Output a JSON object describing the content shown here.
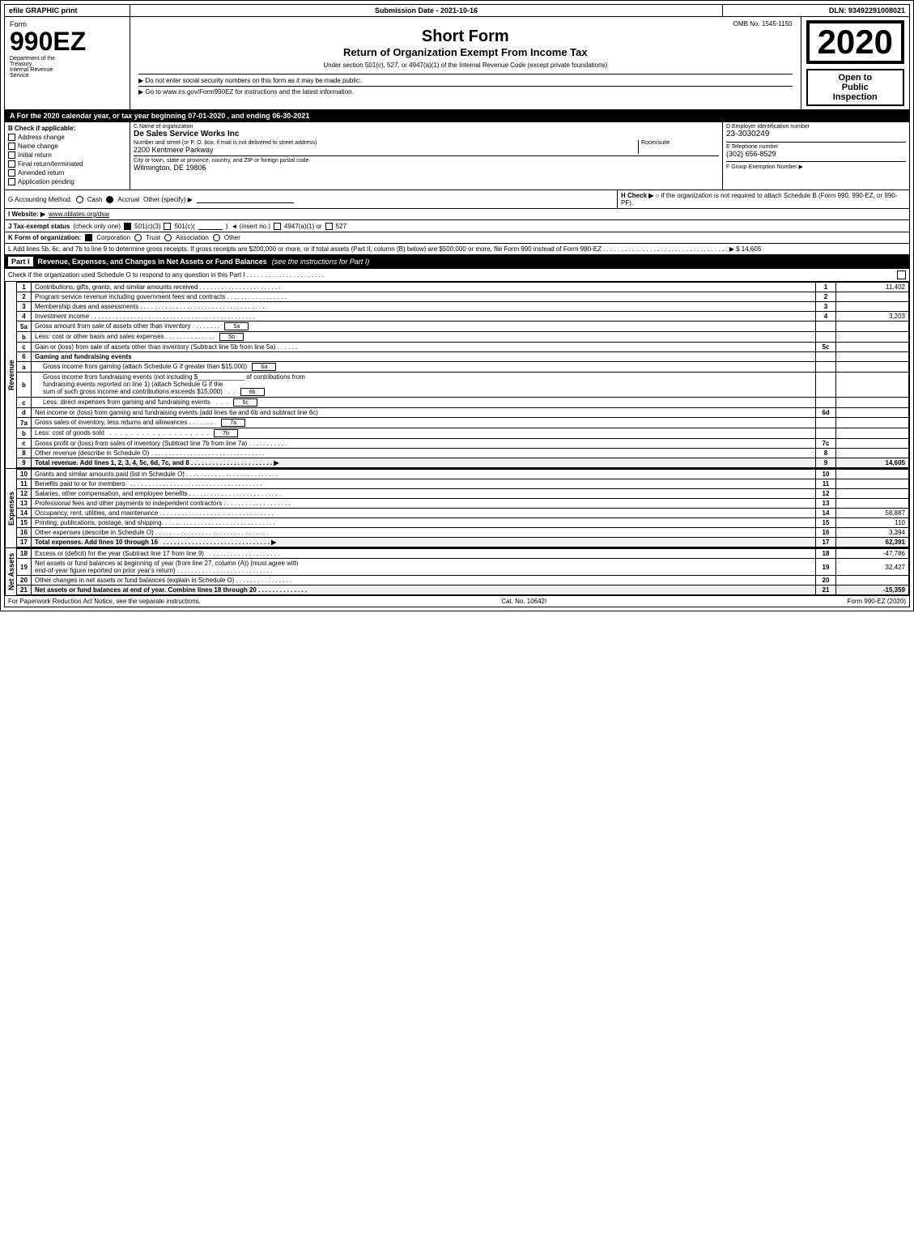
{
  "header": {
    "efile_label": "efile GRAPHIC print",
    "submission_label": "Submission Date - 2021-10-16",
    "dln_label": "DLN: 93492291008021"
  },
  "form_info": {
    "omb": "OMB No. 1545-1150",
    "form_number": "990EZ",
    "form_label": "Form",
    "short_form": "Short Form",
    "return_title": "Return of Organization Exempt From Income Tax",
    "subtitle": "Under section 501(c), 527, or 4947(a)(1) of the Internal Revenue Code (except private foundations)",
    "year": "2020",
    "note1": "▶ Do not enter social security numbers on this form as it may be made public.",
    "note2": "▶ Go to www.irs.gov/Form990EZ for instructions and the latest information.",
    "dept_line1": "Department of the",
    "dept_line2": "Treasury",
    "dept_line3": "Internal Revenue",
    "dept_line4": "Service"
  },
  "open_to_public": {
    "line1": "Open to",
    "line2": "Public",
    "line3": "Inspection"
  },
  "section_A": {
    "year_line": "A For the 2020 calendar year, or tax year beginning 07-01-2020 , and ending 06-30-2021",
    "check_label": "B Check if applicable:",
    "checks": [
      {
        "label": "Address change",
        "checked": false
      },
      {
        "label": "Name change",
        "checked": false
      },
      {
        "label": "Initial return",
        "checked": false
      },
      {
        "label": "Final return/terminated",
        "checked": false
      },
      {
        "label": "Amended return",
        "checked": false
      },
      {
        "label": "Application pending",
        "checked": false
      }
    ],
    "c_label": "C Name of organization",
    "org_name": "De Sales Service Works Inc",
    "address_label": "Number and street (or P. O. box, if mail is not delivered to street address)",
    "address_value": "2200 Kentmere Parkway",
    "room_suite_label": "Room/suite",
    "room_suite_value": "",
    "city_label": "City or town, state or province, country, and ZIP or foreign postal code",
    "city_value": "Wilmington, DE  19806",
    "d_label": "D Employer identification number",
    "ein": "23-3030249",
    "e_label": "E Telephone number",
    "phone": "(302) 656-8529",
    "f_label": "F Group Exemption Number",
    "f_arrow": "▶"
  },
  "accounting": {
    "g_label": "G Accounting Method:",
    "cash_label": "Cash",
    "cash_checked": false,
    "accrual_label": "Accrual",
    "accrual_checked": true,
    "other_label": "Other (specify) ▶",
    "other_line": "___________________________",
    "h_label": "H Check ▶",
    "h_text": "○ if the organization is not required to attach Schedule B (Form 990, 990-EZ, or 990-PF)."
  },
  "website": {
    "i_label": "I Website: ▶",
    "url": "www.oblates.org/dsw"
  },
  "tax_status": {
    "j_label": "J Tax-exempt status",
    "j_note": "(check only one)",
    "checked_501c3": true,
    "label_501c3": "501(c)(3)",
    "label_501c": "501(c)(",
    "insert_no": "insert no.",
    "label_4947": "4947(a)(1) or",
    "label_527": "527"
  },
  "form_org": {
    "k_label": "K Form of organization:",
    "corp_label": "Corporation",
    "corp_checked": true,
    "trust_label": "Trust",
    "trust_checked": false,
    "assoc_label": "Association",
    "assoc_checked": false,
    "other_label": "Other"
  },
  "note_L": {
    "text": "L Add lines 5b, 6c, and 7b to line 9 to determine gross receipts. If gross receipts are $200,000 or more, or if total assets (Part II, column (B) below) are $500,000 or more, file Form 990 instead of Form 990-EZ . . . . . . . . . . . . . . . . . . . . . . . . . . . . . . . . . . . ▶ $ 14,605"
  },
  "part1": {
    "header": "Revenue, Expenses, and Changes in Net Assets or Fund Balances",
    "header_note": "(see the instructions for Part I)",
    "check_note": "Check if the organization used Schedule O to respond to any question in this Part I . . . . . . . . . . . . . . . . . . . . . .",
    "side_label": "Revenue",
    "rows": [
      {
        "num": "1",
        "label": "",
        "desc": "Contributions, gifts, grants, and similar amounts received . . . . . . . . . . . . . . . . . . . . . . .",
        "ref": "1",
        "value": "11,402",
        "indent": 0
      },
      {
        "num": "2",
        "label": "",
        "desc": "Program service revenue including government fees and contracts . . . . . . . . . . . . . . . . .",
        "ref": "2",
        "value": "",
        "indent": 0
      },
      {
        "num": "3",
        "label": "",
        "desc": "Membership dues and assessments . . . . . . . . . . . . . . . . . . . . . . . . . . . . . . . . . . . .",
        "ref": "3",
        "value": "",
        "indent": 0
      },
      {
        "num": "4",
        "label": "",
        "desc": "Investment income . . . . . . . . . . . . . . . . . . . . . . . . . . . . . . . . . . . . . . . . . . . . . .",
        "ref": "4",
        "value": "3,203",
        "indent": 0
      },
      {
        "num": "5a",
        "label": "",
        "desc": "Gross amount from sale of assets other than inventory . . . . . . . . .",
        "ref": "5a",
        "value": "",
        "indent": 0,
        "has_ref_box": true
      },
      {
        "num": "b",
        "label": "",
        "desc": "Less: cost or other basis and sales expenses . . . . . . . . . . . . . . .",
        "ref": "5b",
        "value": "",
        "indent": 0,
        "has_ref_box": true
      },
      {
        "num": "c",
        "label": "",
        "desc": "Gain or (loss) from sale of assets other than inventory (Subtract line 5b from line 5a) . . . . . .",
        "ref": "5c",
        "value": "",
        "indent": 0
      },
      {
        "num": "6",
        "label": "",
        "desc": "Gaming and fundraising events",
        "ref": "",
        "value": "",
        "indent": 0,
        "is_header": true
      },
      {
        "num": "a",
        "label": "",
        "desc": "Gross income from gaming (attach Schedule G if greater than $15,000)",
        "ref": "6a",
        "value": "",
        "indent": 1,
        "has_ref_box": true
      },
      {
        "num": "b",
        "label": "",
        "desc": "Gross income from fundraising events (not including $_____________ of contributions from fundraising events reported on line 1) (attach Schedule G if the sum of such gross income and contributions exceeds $15,000)    .   .",
        "ref": "6b",
        "value": "",
        "indent": 1,
        "has_ref_box": true
      },
      {
        "num": "c",
        "label": "",
        "desc": "Less: direct expenses from gaming and fundraising events    .   .   .",
        "ref": "6c",
        "value": "",
        "indent": 1,
        "has_ref_box": true
      },
      {
        "num": "d",
        "label": "",
        "desc": "Net income or (loss) from gaming and fundraising events (add lines 6a and 6b and subtract line 6c)",
        "ref": "6d",
        "value": "",
        "indent": 0
      },
      {
        "num": "7a",
        "label": "",
        "desc": "Gross sales of inventory, less returns and allowances . . . . . . . . .",
        "ref": "7a",
        "value": "",
        "indent": 0,
        "has_ref_box": true
      },
      {
        "num": "b",
        "label": "",
        "desc": "Less: cost of goods sold        .   .   .   .   .   .   .   .   .   .   .   .   .   .   .   .   .   .   .   .",
        "ref": "7b",
        "value": "",
        "indent": 0,
        "has_ref_box": true
      },
      {
        "num": "c",
        "label": "",
        "desc": "Gross profit or (loss) from sales of inventory (Subtract line 7b from line 7a) . . . . . . . . . . .",
        "ref": "7c",
        "value": "",
        "indent": 0
      },
      {
        "num": "8",
        "label": "",
        "desc": "Other revenue (describe in Schedule O) . . . . . . . . . . . . . . . . . . . . . . . . . . . . . . . .",
        "ref": "8",
        "value": "",
        "indent": 0
      },
      {
        "num": "9",
        "label": "",
        "desc": "Total revenue. Add lines 1, 2, 3, 4, 5c, 6d, 7c, and 8 . . . . . . . . . . . . . . . . . . . . . . . ▶",
        "ref": "9",
        "value": "14,605",
        "indent": 0,
        "bold": true
      }
    ],
    "expenses_label": "Expenses",
    "expense_rows": [
      {
        "num": "10",
        "desc": "Grants and similar amounts paid (list in Schedule O) . . . . . . . . . . . . . . . . . . . . . . . . . .",
        "ref": "10",
        "value": ""
      },
      {
        "num": "11",
        "desc": "Benefits paid to or for members   . . . . . . . . . . . . . . . . . . . . . . . . . . . . . . . . . . . . .",
        "ref": "11",
        "value": ""
      },
      {
        "num": "12",
        "desc": "Salaries, other compensation, and employee benefits . . . . . . . . . . . . . . . . . . . . . . . . . .",
        "ref": "12",
        "value": ""
      },
      {
        "num": "13",
        "desc": "Professional fees and other payments to independent contractors . . . . . . . . . . . . . . . . . . .",
        "ref": "13",
        "value": ""
      },
      {
        "num": "14",
        "desc": "Occupancy, rent, utilities, and maintenance . . . . . . . . . . . . . . . . . . . . . . . . . . . . . . . .",
        "ref": "14",
        "value": "58,887"
      },
      {
        "num": "15",
        "desc": "Printing, publications, postage, and shipping. . . . . . . . . . . . . . . . . . . . . . . . . . . . . . . .",
        "ref": "15",
        "value": "110"
      },
      {
        "num": "16",
        "desc": "Other expenses (describe in Schedule O) . . . . . . . . . . . . . . . . . . . . . . . . . . . . . . . .",
        "ref": "16",
        "value": "3,394"
      },
      {
        "num": "17",
        "desc": "Total expenses. Add lines 10 through 16    . . . . . . . . . . . . . . . . . . . . . . . . . . . . . ▶",
        "ref": "17",
        "value": "62,391",
        "bold": true
      }
    ],
    "net_assets_label": "Net Assets",
    "net_rows": [
      {
        "num": "18",
        "desc": "Excess or (deficit) for the year (Subtract line 17 from line 9)    . . . . . . . . . . . . . . . . . . . .",
        "ref": "18",
        "value": "-47,786"
      },
      {
        "num": "19",
        "desc": "Net assets or fund balances at beginning of year (from line 27, column (A)) (must agree with end-of-year figure reported on prior year's return) . . . . . . . . . . . . . . . . . . . . . . . . . . .",
        "ref": "19",
        "value": "32,427"
      },
      {
        "num": "20",
        "desc": "Other changes in net assets or fund balances (explain in Schedule O) . . . . . . . . . . . . . . . .",
        "ref": "20",
        "value": ""
      },
      {
        "num": "21",
        "desc": "Net assets or fund balances at end of year. Combine lines 18 through 20 . . . . . . . . . . . . . .",
        "ref": "21",
        "value": "-15,359",
        "bold": true
      }
    ]
  },
  "footer": {
    "paperwork_notice": "For Paperwork Reduction Act Notice, see the separate instructions.",
    "cat_no": "Cat. No. 10642I",
    "form_ref": "Form 990-EZ (2020)"
  }
}
